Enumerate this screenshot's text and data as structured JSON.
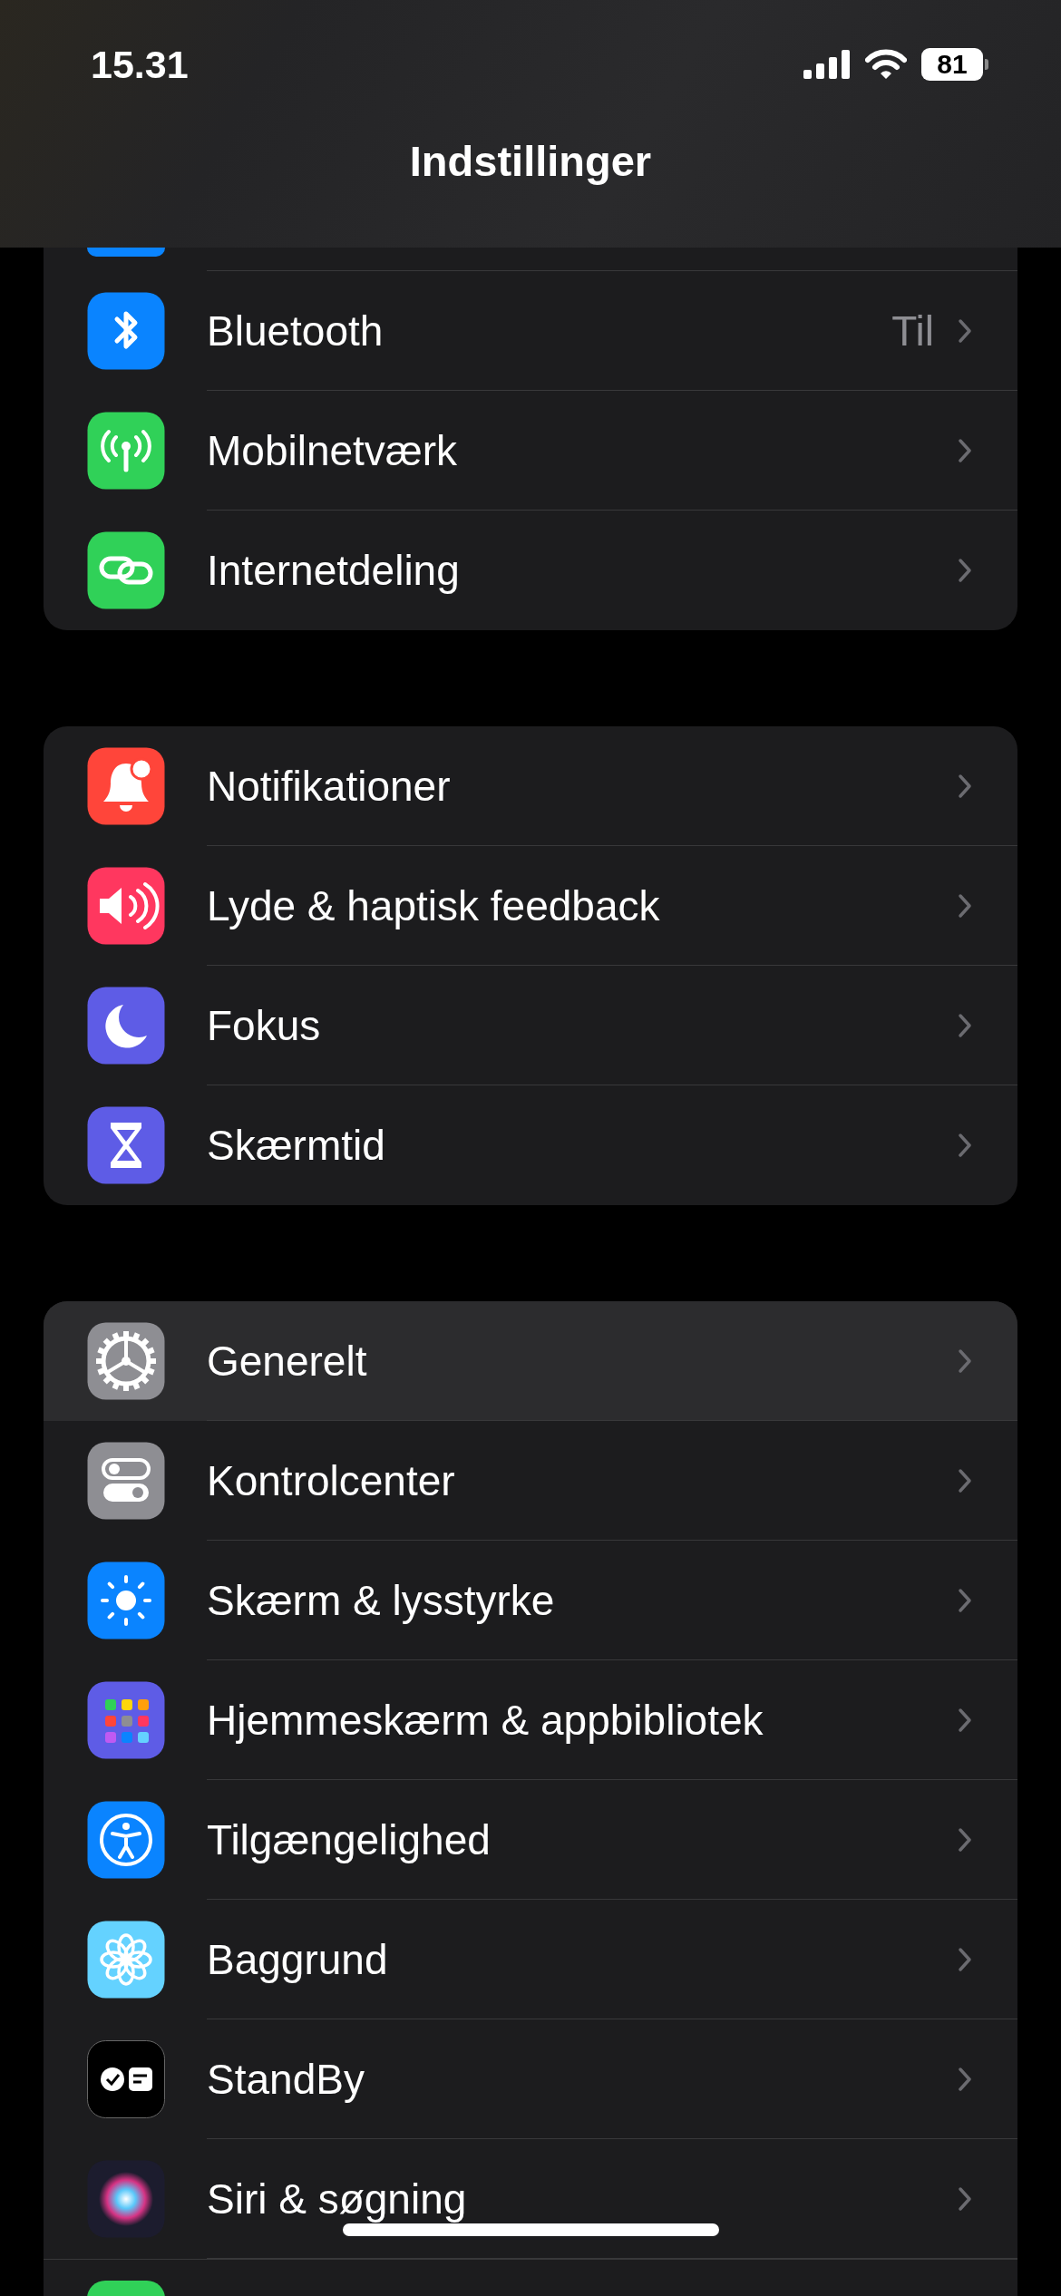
{
  "status_bar": {
    "time": "15.31",
    "battery": "81"
  },
  "title": "Indstillinger",
  "groups": [
    {
      "rows": [
        {
          "kind": "bluetooth",
          "label": "Bluetooth",
          "value": "Til",
          "color": "#0a84ff",
          "selected": false
        },
        {
          "kind": "cellular",
          "label": "Mobilnetværk",
          "color": "#30d158",
          "selected": false
        },
        {
          "kind": "hotspot",
          "label": "Internetdeling",
          "color": "#30d158",
          "selected": false
        }
      ]
    },
    {
      "rows": [
        {
          "kind": "bell",
          "label": "Notifikationer",
          "color": "#ff453a",
          "selected": false
        },
        {
          "kind": "sound",
          "label": "Lyde & haptisk feedback",
          "color": "#ff375f",
          "selected": false
        },
        {
          "kind": "moon",
          "label": "Fokus",
          "color": "#5e5ce6",
          "selected": false
        },
        {
          "kind": "hourglass",
          "label": "Skærmtid",
          "color": "#5e5ce6",
          "selected": false
        }
      ]
    },
    {
      "rows": [
        {
          "kind": "gear",
          "label": "Generelt",
          "color": "#8e8e93",
          "selected": true
        },
        {
          "kind": "switches",
          "label": "Kontrolcenter",
          "color": "#8e8e93",
          "selected": false
        },
        {
          "kind": "sun",
          "label": "Skærm & lysstyrke",
          "color": "#0a84ff",
          "selected": false
        },
        {
          "kind": "grid",
          "label": "Hjemmeskærm & appbibliotek",
          "color": "#5e5ce6",
          "selected": false
        },
        {
          "kind": "accessibility",
          "label": "Tilgængelighed",
          "color": "#0a84ff",
          "selected": false
        },
        {
          "kind": "flower",
          "label": "Baggrund",
          "color": "#64d2ff",
          "selected": false
        },
        {
          "kind": "standby",
          "label": "StandBy",
          "color": "#000000",
          "selected": false
        },
        {
          "kind": "siri",
          "label": "Siri & søgning",
          "color": "#1c1c2e",
          "selected": false
        }
      ]
    }
  ]
}
